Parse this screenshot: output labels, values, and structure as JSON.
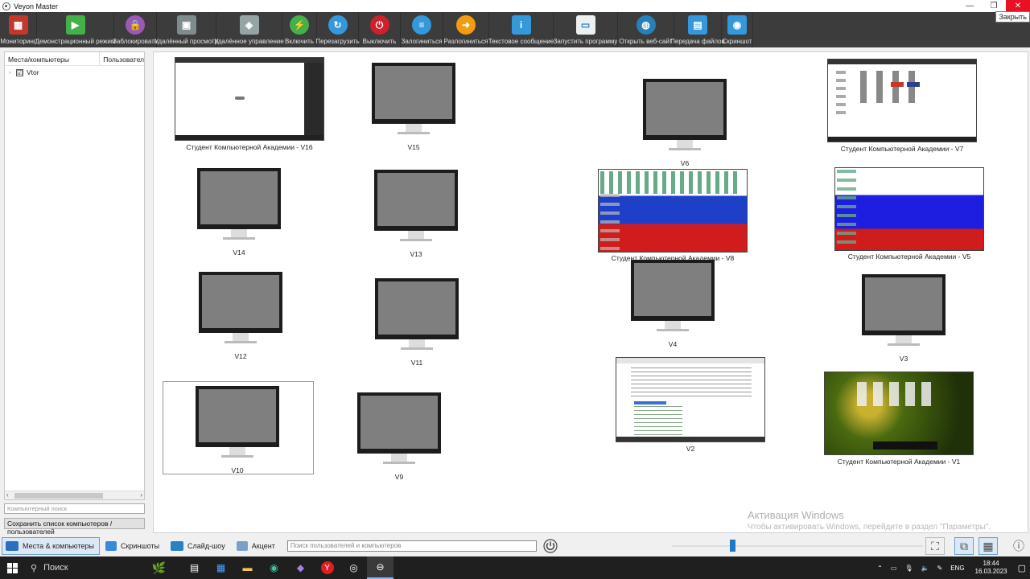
{
  "window": {
    "title": "Veyon Master",
    "minimize": "—",
    "maximize": "❐",
    "close": "✕",
    "close_tooltip": "Закрыть"
  },
  "toolbar": [
    {
      "id": "monitoring",
      "label": "Мониторинг",
      "icon": "grid-icon",
      "color": "#c0392b"
    },
    {
      "id": "demo",
      "label": "Демонстрационный режим",
      "icon": "presentation-icon",
      "color": "#43b049"
    },
    {
      "id": "lock",
      "label": "Заблокировать",
      "icon": "lock-icon",
      "color": "#9b59b6"
    },
    {
      "id": "remote-view",
      "label": "Удалённый просмотр",
      "icon": "remote-view-icon",
      "color": "#7f8c8d"
    },
    {
      "id": "remote-control",
      "label": "Удалённое управление",
      "icon": "remote-control-icon",
      "color": "#95a5a6"
    },
    {
      "id": "power-on",
      "label": "Включить",
      "icon": "power-on-icon",
      "color": "#43b049"
    },
    {
      "id": "reboot",
      "label": "Перезагрузить",
      "icon": "reboot-icon",
      "color": "#3498db"
    },
    {
      "id": "power-off",
      "label": "Выключить",
      "icon": "power-off-icon",
      "color": "#d0202a"
    },
    {
      "id": "login",
      "label": "Залогиниться",
      "icon": "login-icon",
      "color": "#3498db"
    },
    {
      "id": "logout",
      "label": "Разлогиниться",
      "icon": "logout-icon",
      "color": "#f39c12"
    },
    {
      "id": "message",
      "label": "Текстовое сообщение",
      "icon": "message-icon",
      "color": "#3498db"
    },
    {
      "id": "run-program",
      "label": "Запустить программу",
      "icon": "run-program-icon",
      "color": "#ecf0f1"
    },
    {
      "id": "open-website",
      "label": "Открыть веб-сайт",
      "icon": "globe-icon",
      "color": "#2980b9"
    },
    {
      "id": "file-transfer",
      "label": "Передача файлов",
      "icon": "file-transfer-icon",
      "color": "#3498db"
    },
    {
      "id": "screenshot",
      "label": "Скриншот",
      "icon": "camera-icon",
      "color": "#3498db"
    }
  ],
  "tree": {
    "col_places": "Места/компьютеры",
    "col_users": "Пользовател",
    "items": [
      {
        "label": "Vtor",
        "checked": "☑"
      }
    ]
  },
  "left_bottom": {
    "search_placeholder": "Компьютерный поиск",
    "save_label": "Сохранить список компьютеров / пользователей"
  },
  "tiles": {
    "v16": "Студент Компьютерной Академии - V16",
    "v15": "V15",
    "v6": "V6",
    "v7": "Студент Компьютерной Академии - V7",
    "v14": "V14",
    "v13": "V13",
    "v8": "Студент Компьютерной Академии - V8",
    "v5": "Студент Компьютерной Академии - V5",
    "v12": "V12",
    "v11": "V11",
    "v4": "V4",
    "v3": "V3",
    "v10": "V10",
    "v9": "V9",
    "v2": "V2",
    "v1": "Студент Компьютерной Академии - V1"
  },
  "watermark": {
    "line1": "Активация Windows",
    "line2": "Чтобы активировать Windows, перейдите в раздел \"Параметры\"."
  },
  "bottombar": {
    "tab_computers": "Места & компьютеры",
    "tab_screenshots": "Скриншоты",
    "tab_slideshow": "Слайд-шоу",
    "tab_spotlight": "Акцент",
    "user_search_placeholder": "Поиск пользователей и компьютеров",
    "zoom_percent": 24
  },
  "taskbar": {
    "search_label": "Поиск",
    "lang": "ENG",
    "time": "18:44",
    "date": "16.03.2023"
  }
}
